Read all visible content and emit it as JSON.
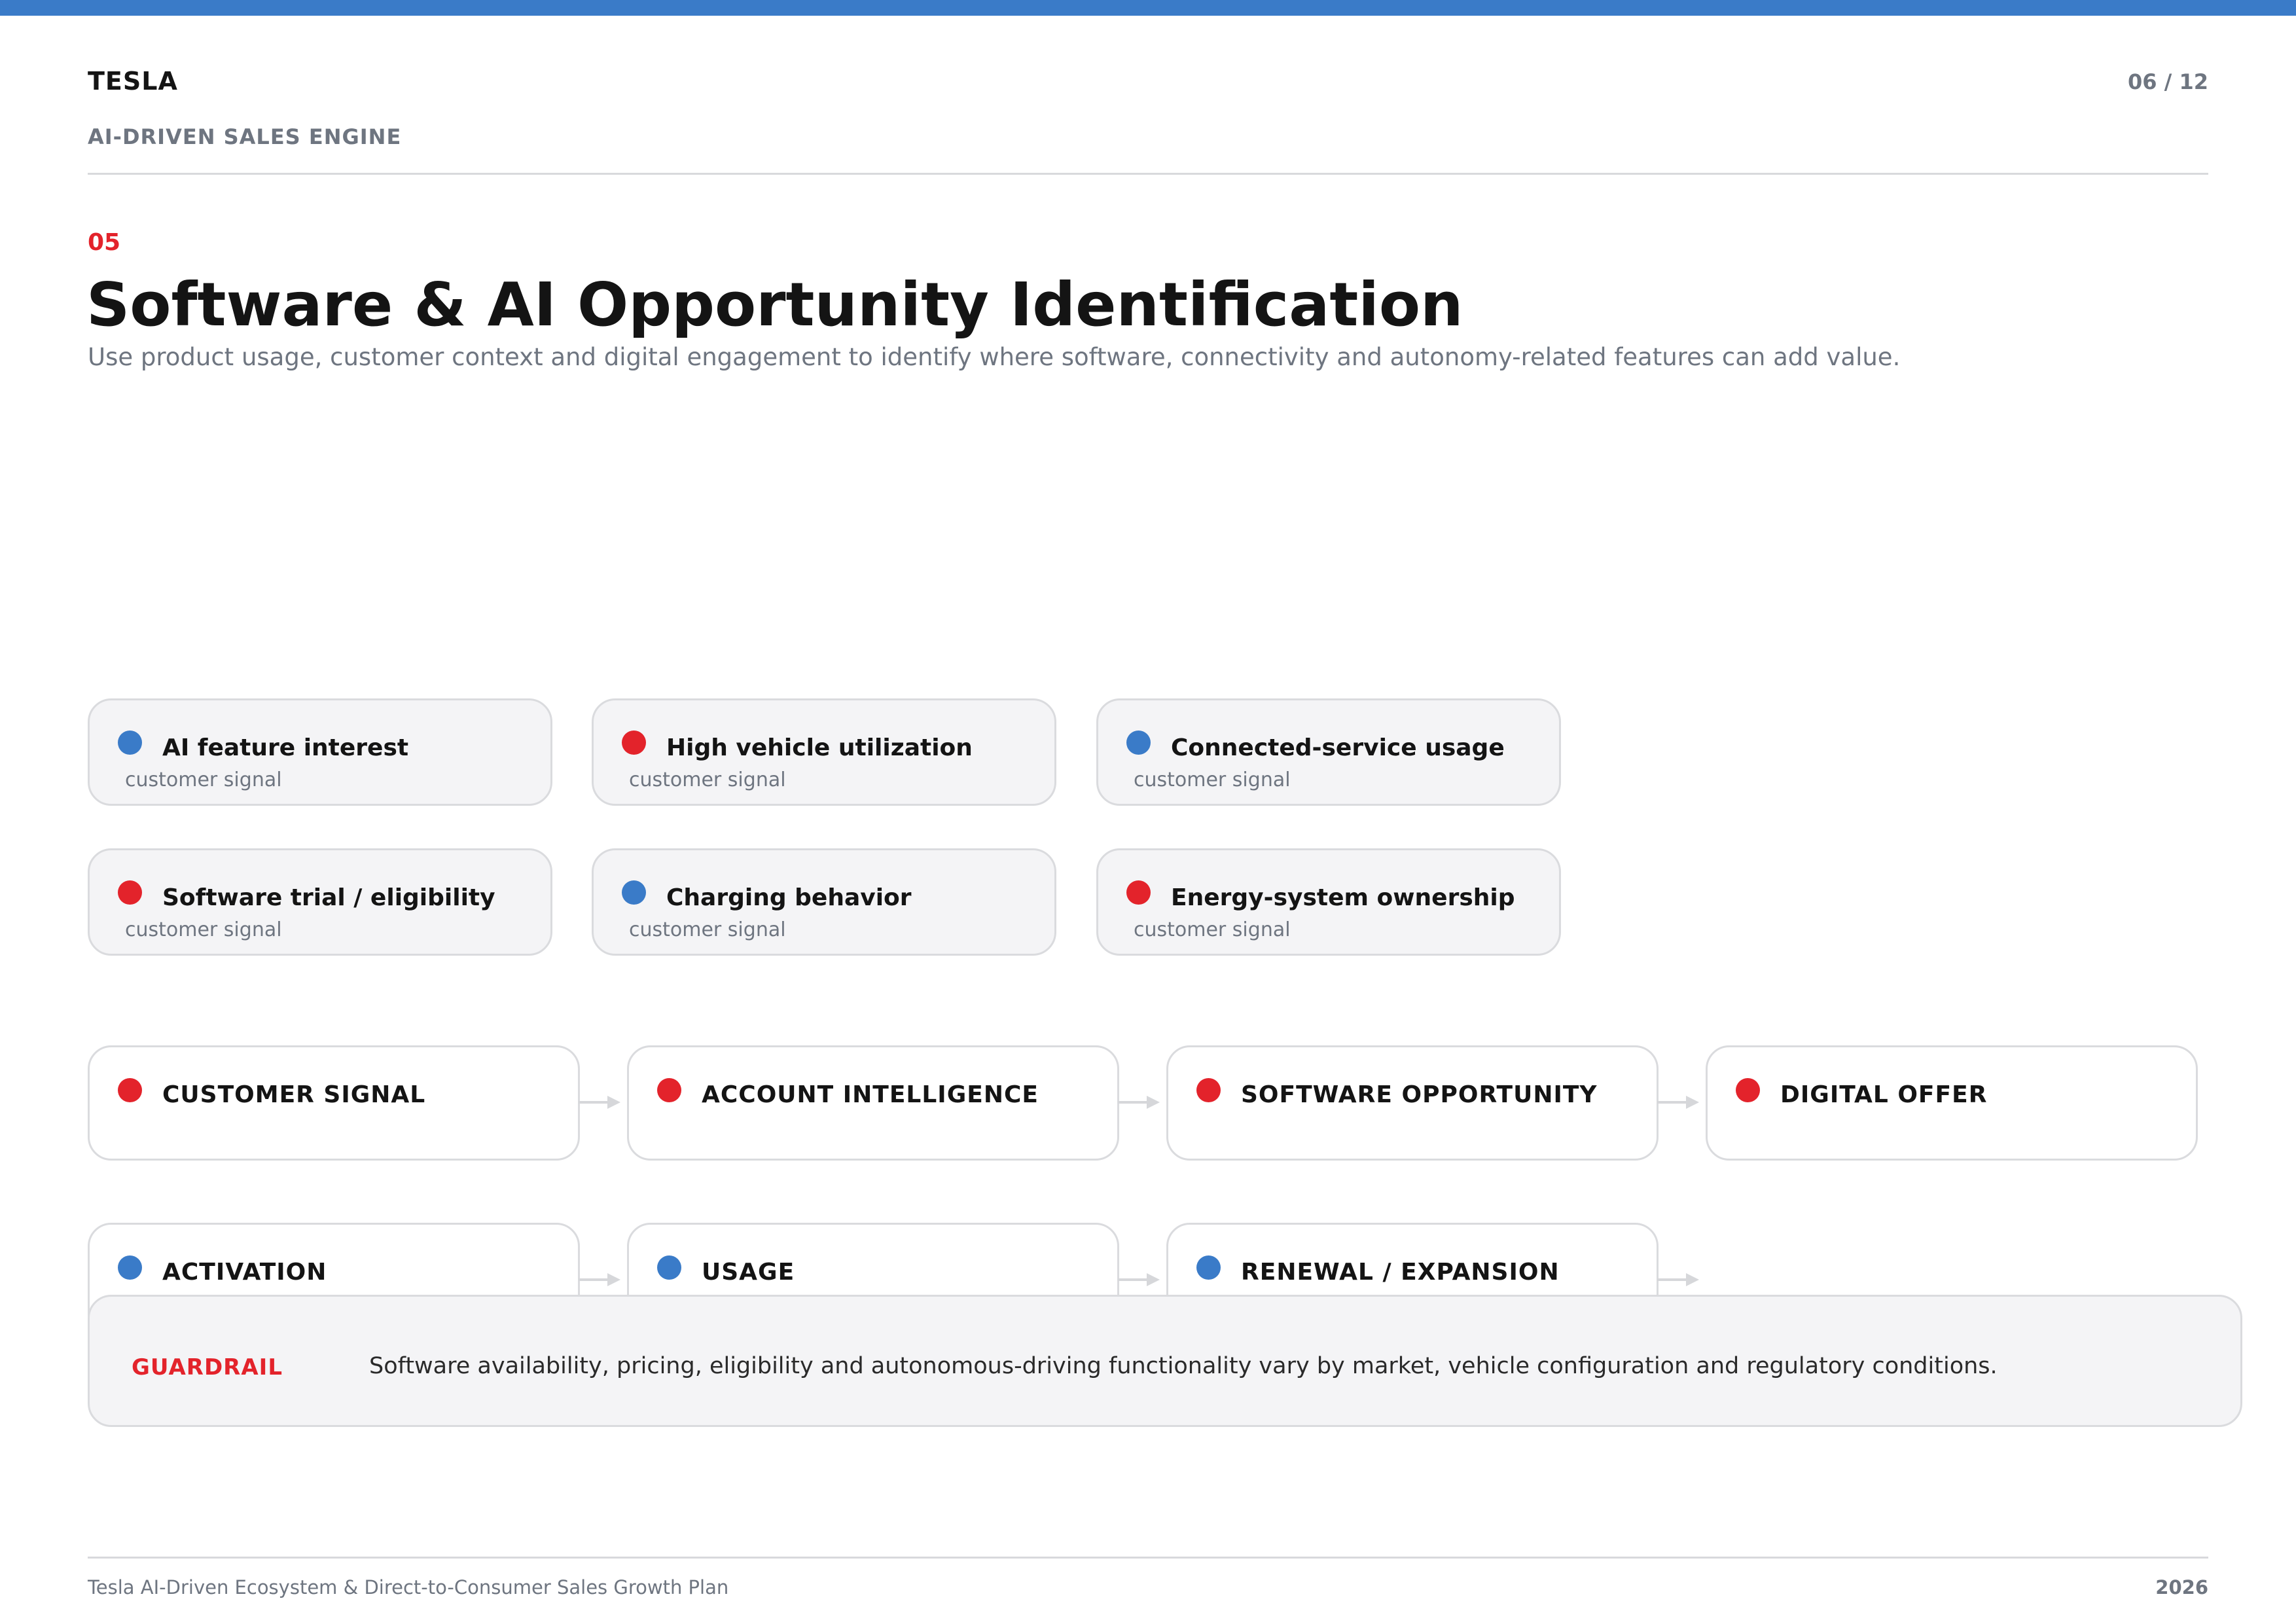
{
  "header": {
    "brand": "TESLA",
    "section_label": "AI-DRIVEN SALES ENGINE",
    "page_number": "06 / 12"
  },
  "slide": {
    "number": "05",
    "title": "Software & AI Opportunity Identification",
    "subtitle": "Use product usage, customer context and digital engagement to identify where software, connectivity and autonomy-related features can add value."
  },
  "signals": [
    {
      "title": "AI feature interest",
      "sub": "customer signal",
      "color": "blue"
    },
    {
      "title": "High vehicle utilization",
      "sub": "customer signal",
      "color": "red"
    },
    {
      "title": "Connected-service usage",
      "sub": "customer signal",
      "color": "blue"
    },
    {
      "title": "Software trial / eligibility",
      "sub": "customer signal",
      "color": "red"
    },
    {
      "title": "Charging behavior",
      "sub": "customer signal",
      "color": "blue"
    },
    {
      "title": "Energy-system ownership",
      "sub": "customer signal",
      "color": "red"
    }
  ],
  "flow": {
    "row1": [
      {
        "label": "CUSTOMER SIGNAL",
        "color": "red"
      },
      {
        "label": "ACCOUNT INTELLIGENCE",
        "color": "red"
      },
      {
        "label": "SOFTWARE OPPORTUNITY",
        "color": "red"
      },
      {
        "label": "DIGITAL OFFER",
        "color": "red"
      }
    ],
    "row2": [
      {
        "label": "ACTIVATION",
        "color": "blue"
      },
      {
        "label": "USAGE",
        "color": "blue"
      },
      {
        "label": "RENEWAL / EXPANSION",
        "color": "blue"
      }
    ]
  },
  "guardrail": {
    "label": "GUARDRAIL",
    "text": "Software availability, pricing, eligibility and autonomous-driving functionality vary by market, vehicle configuration and regulatory conditions."
  },
  "footer": {
    "left": "Tesla AI-Driven Ecosystem & Direct-to-Consumer Sales Growth Plan",
    "right": "2026"
  },
  "colors": {
    "accent_blue": "#3a7bc8",
    "accent_red": "#e3232b",
    "muted_text": "#6e7580",
    "card_fill": "#f4f4f6",
    "card_border": "#dadbde"
  }
}
